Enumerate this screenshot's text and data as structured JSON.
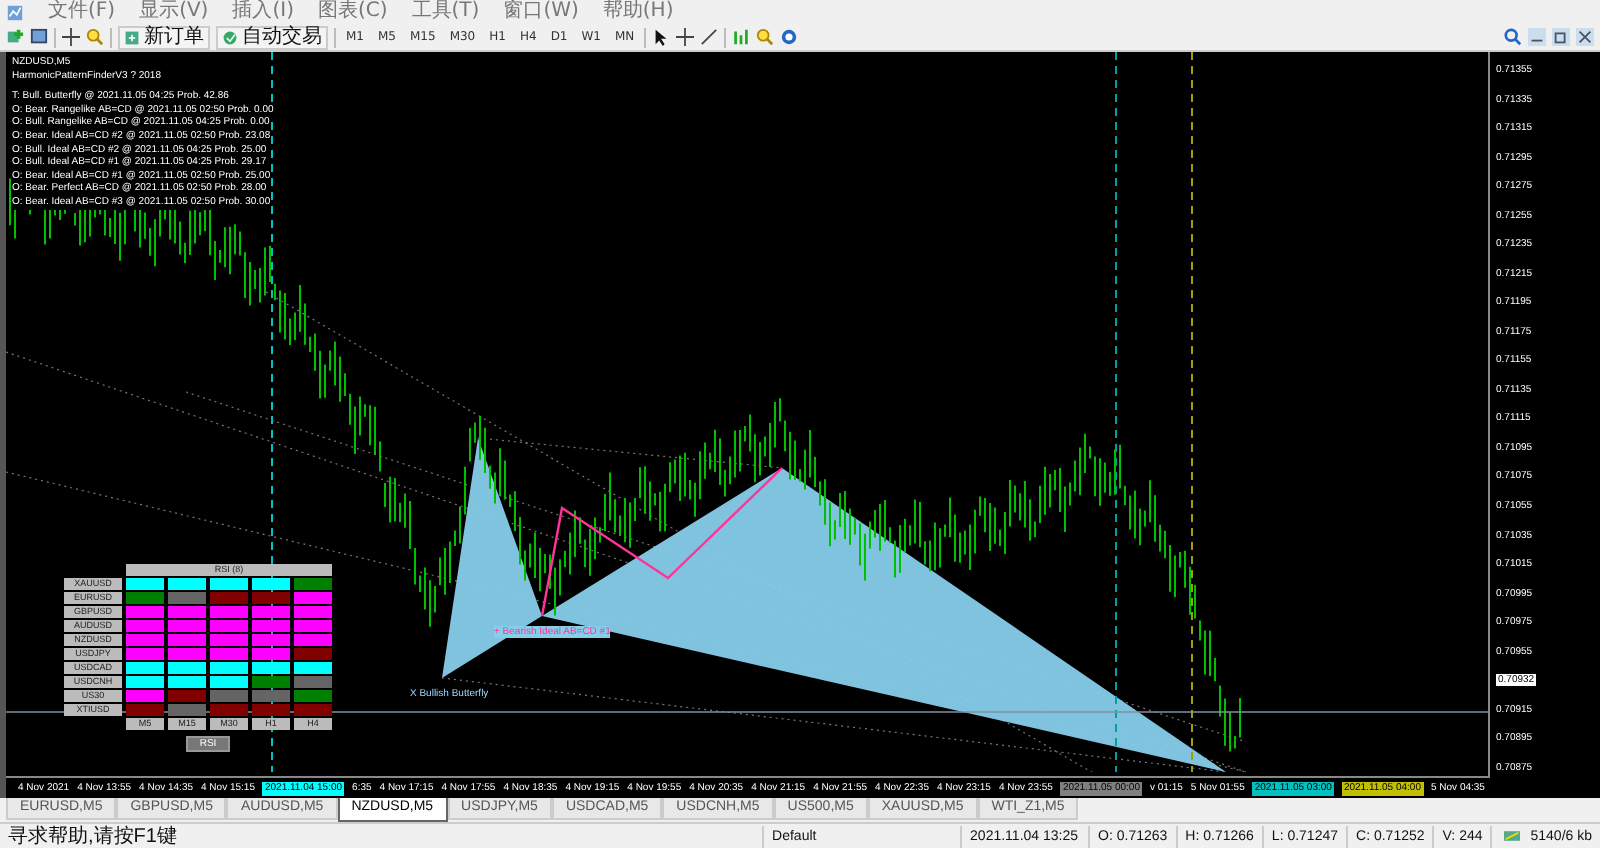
{
  "menu": [
    "文件(F)",
    "显示(V)",
    "插入(I)",
    "图表(C)",
    "工具(T)",
    "窗口(W)",
    "帮助(H)"
  ],
  "toolbar": {
    "buttons": [
      "新订单",
      "自动交易"
    ],
    "timeframes": [
      "M1",
      "M5",
      "M15",
      "M30",
      "H1",
      "H4",
      "D1",
      "W1",
      "MN"
    ]
  },
  "chart": {
    "symbol": "NZDUSD,M5",
    "indicator": "HarmonicPatternFinderV3 ? 2018",
    "pattern_lines": [
      "T: Bull. Butterfly @ 2021.11.05 04:25 Prob. 42.86",
      "O: Bear. Rangelike AB=CD @ 2021.11.05 02:50 Prob. 0.00",
      "O: Bull. Rangelike AB=CD @ 2021.11.05 04:25 Prob. 0.00",
      "O: Bear. Ideal AB=CD #2 @ 2021.11.05 02:50 Prob. 23.08",
      "O: Bull. Ideal AB=CD #2 @ 2021.11.05 04:25 Prob. 25.00",
      "O: Bull. Ideal AB=CD #1 @ 2021.11.05 04:25 Prob. 29.17",
      "O: Bear. Ideal AB=CD #1 @ 2021.11.05 02:50 Prob. 25.00",
      "O: Bear. Perfect AB=CD @ 2021.11.05 02:50 Prob. 28.00",
      "O: Bear. Ideal AB=CD #3 @ 2021.11.05 02:50 Prob. 30.00"
    ],
    "pattern_label": "X Bullish Butterfly",
    "abcd_label": "+ Bearish Ideal AB=CD #1",
    "rsi_panel": {
      "title": "RSI (8)",
      "columns": [
        "M5",
        "M15",
        "M30",
        "H1",
        "H4"
      ],
      "button": "RSI",
      "rows": [
        {
          "symbol": "XAUUSD",
          "cells": [
            {
              "color": "#00ffff"
            },
            {
              "color": "#00ffff"
            },
            {
              "color": "#00ffff"
            },
            {
              "color": "#00ffff"
            },
            {
              "color": "#008000"
            }
          ]
        },
        {
          "symbol": "EURUSD",
          "cells": [
            {
              "color": "#008000"
            },
            {
              "color": "#646464"
            },
            {
              "color": "#800000"
            },
            {
              "color": "#800000"
            },
            {
              "color": "#ff00ff"
            }
          ]
        },
        {
          "symbol": "GBPUSD",
          "cells": [
            {
              "color": "#ff00ff"
            },
            {
              "color": "#ff00ff"
            },
            {
              "color": "#ff00ff"
            },
            {
              "color": "#ff00ff"
            },
            {
              "color": "#ff00ff"
            }
          ]
        },
        {
          "symbol": "AUDUSD",
          "cells": [
            {
              "color": "#ff00ff"
            },
            {
              "color": "#ff00ff"
            },
            {
              "color": "#ff00ff"
            },
            {
              "color": "#ff00ff"
            },
            {
              "color": "#ff00ff"
            }
          ]
        },
        {
          "symbol": "NZDUSD",
          "cells": [
            {
              "color": "#ff00ff"
            },
            {
              "color": "#ff00ff"
            },
            {
              "color": "#ff00ff"
            },
            {
              "color": "#ff00ff"
            },
            {
              "color": "#ff00ff"
            }
          ]
        },
        {
          "symbol": "USDJPY",
          "cells": [
            {
              "color": "#ff00ff"
            },
            {
              "color": "#ff00ff"
            },
            {
              "color": "#ff00ff"
            },
            {
              "color": "#ff00ff"
            },
            {
              "color": "#800000"
            }
          ]
        },
        {
          "symbol": "USDCAD",
          "cells": [
            {
              "color": "#00ffff"
            },
            {
              "color": "#00ffff"
            },
            {
              "color": "#00ffff"
            },
            {
              "color": "#00ffff"
            },
            {
              "color": "#00ffff"
            }
          ]
        },
        {
          "symbol": "USDCNH",
          "cells": [
            {
              "color": "#00ffff"
            },
            {
              "color": "#00ffff"
            },
            {
              "color": "#00ffff"
            },
            {
              "color": "#008000"
            },
            {
              "color": "#646464"
            }
          ]
        },
        {
          "symbol": "US30",
          "cells": [
            {
              "color": "#ff00ff"
            },
            {
              "color": "#800000"
            },
            {
              "color": "#646464"
            },
            {
              "color": "#646464"
            },
            {
              "color": "#008000"
            }
          ]
        },
        {
          "symbol": "XTIUSD",
          "cells": [
            {
              "color": "#800000"
            },
            {
              "color": "#646464"
            },
            {
              "color": "#800000"
            },
            {
              "color": "#800000"
            },
            {
              "color": "#800000"
            }
          ]
        }
      ]
    },
    "price_labels": [
      {
        "text": "0.71355",
        "kind": "tick"
      },
      {
        "text": "0.71335",
        "kind": "tick"
      },
      {
        "text": "0.71315",
        "kind": "tick"
      },
      {
        "text": "0.71295",
        "kind": "tick"
      },
      {
        "text": "0.71275",
        "kind": "tick"
      },
      {
        "text": "0.71255",
        "kind": "tick"
      },
      {
        "text": "0.71235",
        "kind": "tick"
      },
      {
        "text": "0.71215",
        "kind": "tick"
      },
      {
        "text": "0.71195",
        "kind": "tick"
      },
      {
        "text": "0.71175",
        "kind": "tick"
      },
      {
        "text": "0.71155",
        "kind": "tick"
      },
      {
        "text": "0.71135",
        "kind": "tick"
      },
      {
        "text": "0.71115",
        "kind": "tick"
      },
      {
        "text": "0.71095",
        "kind": "tick"
      },
      {
        "text": "0.71075",
        "kind": "tick"
      },
      {
        "text": "0.71055",
        "kind": "tick"
      },
      {
        "text": "0.71035",
        "kind": "tick"
      },
      {
        "text": "0.71015",
        "kind": "tick"
      },
      {
        "text": "0.70995",
        "kind": "tick"
      },
      {
        "text": "0.70975",
        "kind": "tick"
      },
      {
        "text": "0.70955",
        "kind": "tick"
      },
      {
        "text": "0.70932",
        "kind": "current"
      },
      {
        "text": "0.70915",
        "kind": "tick"
      },
      {
        "text": "0.70895",
        "kind": "tick"
      },
      {
        "text": "0.70875",
        "kind": "tick"
      }
    ],
    "time_labels": [
      {
        "text": "4 Nov 2021",
        "kind": "tick"
      },
      {
        "text": "4 Nov 13:55",
        "kind": "tick"
      },
      {
        "text": "4 Nov 14:35",
        "kind": "tick"
      },
      {
        "text": "4 Nov 15:15",
        "kind": "tick"
      },
      {
        "text": "2021.11.04 15:00",
        "kind": "marker",
        "color": "#00ffff"
      },
      {
        "text": "6:35",
        "kind": "tick"
      },
      {
        "text": "4 Nov 17:15",
        "kind": "tick"
      },
      {
        "text": "4 Nov 17:55",
        "kind": "tick"
      },
      {
        "text": "4 Nov 18:35",
        "kind": "tick"
      },
      {
        "text": "4 Nov 19:15",
        "kind": "tick"
      },
      {
        "text": "4 Nov 19:55",
        "kind": "tick"
      },
      {
        "text": "4 Nov 20:35",
        "kind": "tick"
      },
      {
        "text": "4 Nov 21:15",
        "kind": "tick"
      },
      {
        "text": "4 Nov 21:55",
        "kind": "tick"
      },
      {
        "text": "4 Nov 22:35",
        "kind": "tick"
      },
      {
        "text": "4 Nov 23:15",
        "kind": "tick"
      },
      {
        "text": "4 Nov 23:55",
        "kind": "tick"
      },
      {
        "text": "2021.11.05 00:00",
        "kind": "marker",
        "color": "#808080"
      },
      {
        "text": "v 01:15",
        "kind": "tick"
      },
      {
        "text": "5 Nov 01:55",
        "kind": "tick"
      },
      {
        "text": "2021.11.05 03:00",
        "kind": "marker",
        "color": "#00c0c0"
      },
      {
        "text": "2021.11.05 04:00",
        "kind": "marker",
        "color": "#c0c000"
      },
      {
        "text": "5 Nov 04:35",
        "kind": "tick"
      }
    ]
  },
  "tabs": [
    {
      "label": "EURUSD,M5",
      "selected": false
    },
    {
      "label": "GBPUSD,M5",
      "selected": false
    },
    {
      "label": "AUDUSD,M5",
      "selected": false
    },
    {
      "label": "NZDUSD,M5",
      "selected": true
    },
    {
      "label": "USDJPY,M5",
      "selected": false
    },
    {
      "label": "USDCAD,M5",
      "selected": false
    },
    {
      "label": "USDCNH,M5",
      "selected": false
    },
    {
      "label": "US500,M5",
      "selected": false
    },
    {
      "label": "XAUUSD,M5",
      "selected": false
    },
    {
      "label": "WTI_Z1,M5",
      "selected": false
    }
  ],
  "status_bar": {
    "help": "寻求帮助,请按F1键",
    "profile": "Default",
    "time": "2021.11.04 13:25",
    "open": "O: 0.71263",
    "high": "H: 0.71266",
    "low": "L: 0.71247",
    "close": "C: 0.71252",
    "volume": "V: 244",
    "traffic": "5140/6 kb"
  }
}
